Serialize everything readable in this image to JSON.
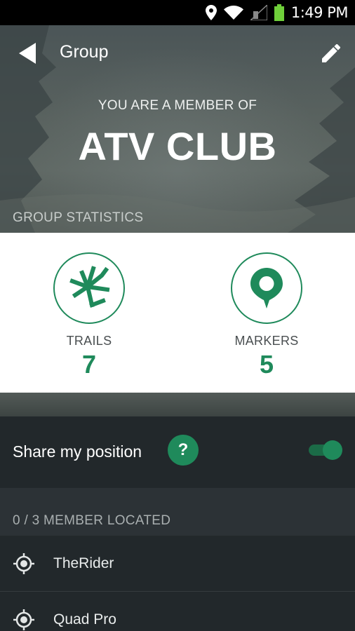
{
  "status_bar": {
    "time": "1:49 PM",
    "icons": [
      "location-icon",
      "wifi-icon",
      "signal-icon",
      "battery-icon"
    ]
  },
  "app_bar": {
    "title": "Group",
    "back_icon": "back-arrow-icon",
    "edit_icon": "edit-pencil-icon"
  },
  "hero": {
    "member_of_text": "YOU ARE A MEMBER OF",
    "group_name": "ATV CLUB"
  },
  "stats": {
    "header": "GROUP STATISTICS",
    "items": [
      {
        "label": "TRAILS",
        "value": "7",
        "icon": "trails-icon"
      },
      {
        "label": "MARKERS",
        "value": "5",
        "icon": "marker-pin-icon"
      }
    ]
  },
  "share": {
    "label": "Share my position",
    "help_label": "?",
    "enabled": true
  },
  "members": {
    "header": "0 / 3 MEMBER LOCATED",
    "items": [
      {
        "name": "TheRider",
        "icon": "crosshair-icon"
      },
      {
        "name": "Quad Pro",
        "icon": "crosshair-icon"
      }
    ]
  },
  "colors": {
    "accent": "#1f8a5b",
    "dark_bg": "#22282b",
    "section_bg": "#2c3236"
  }
}
